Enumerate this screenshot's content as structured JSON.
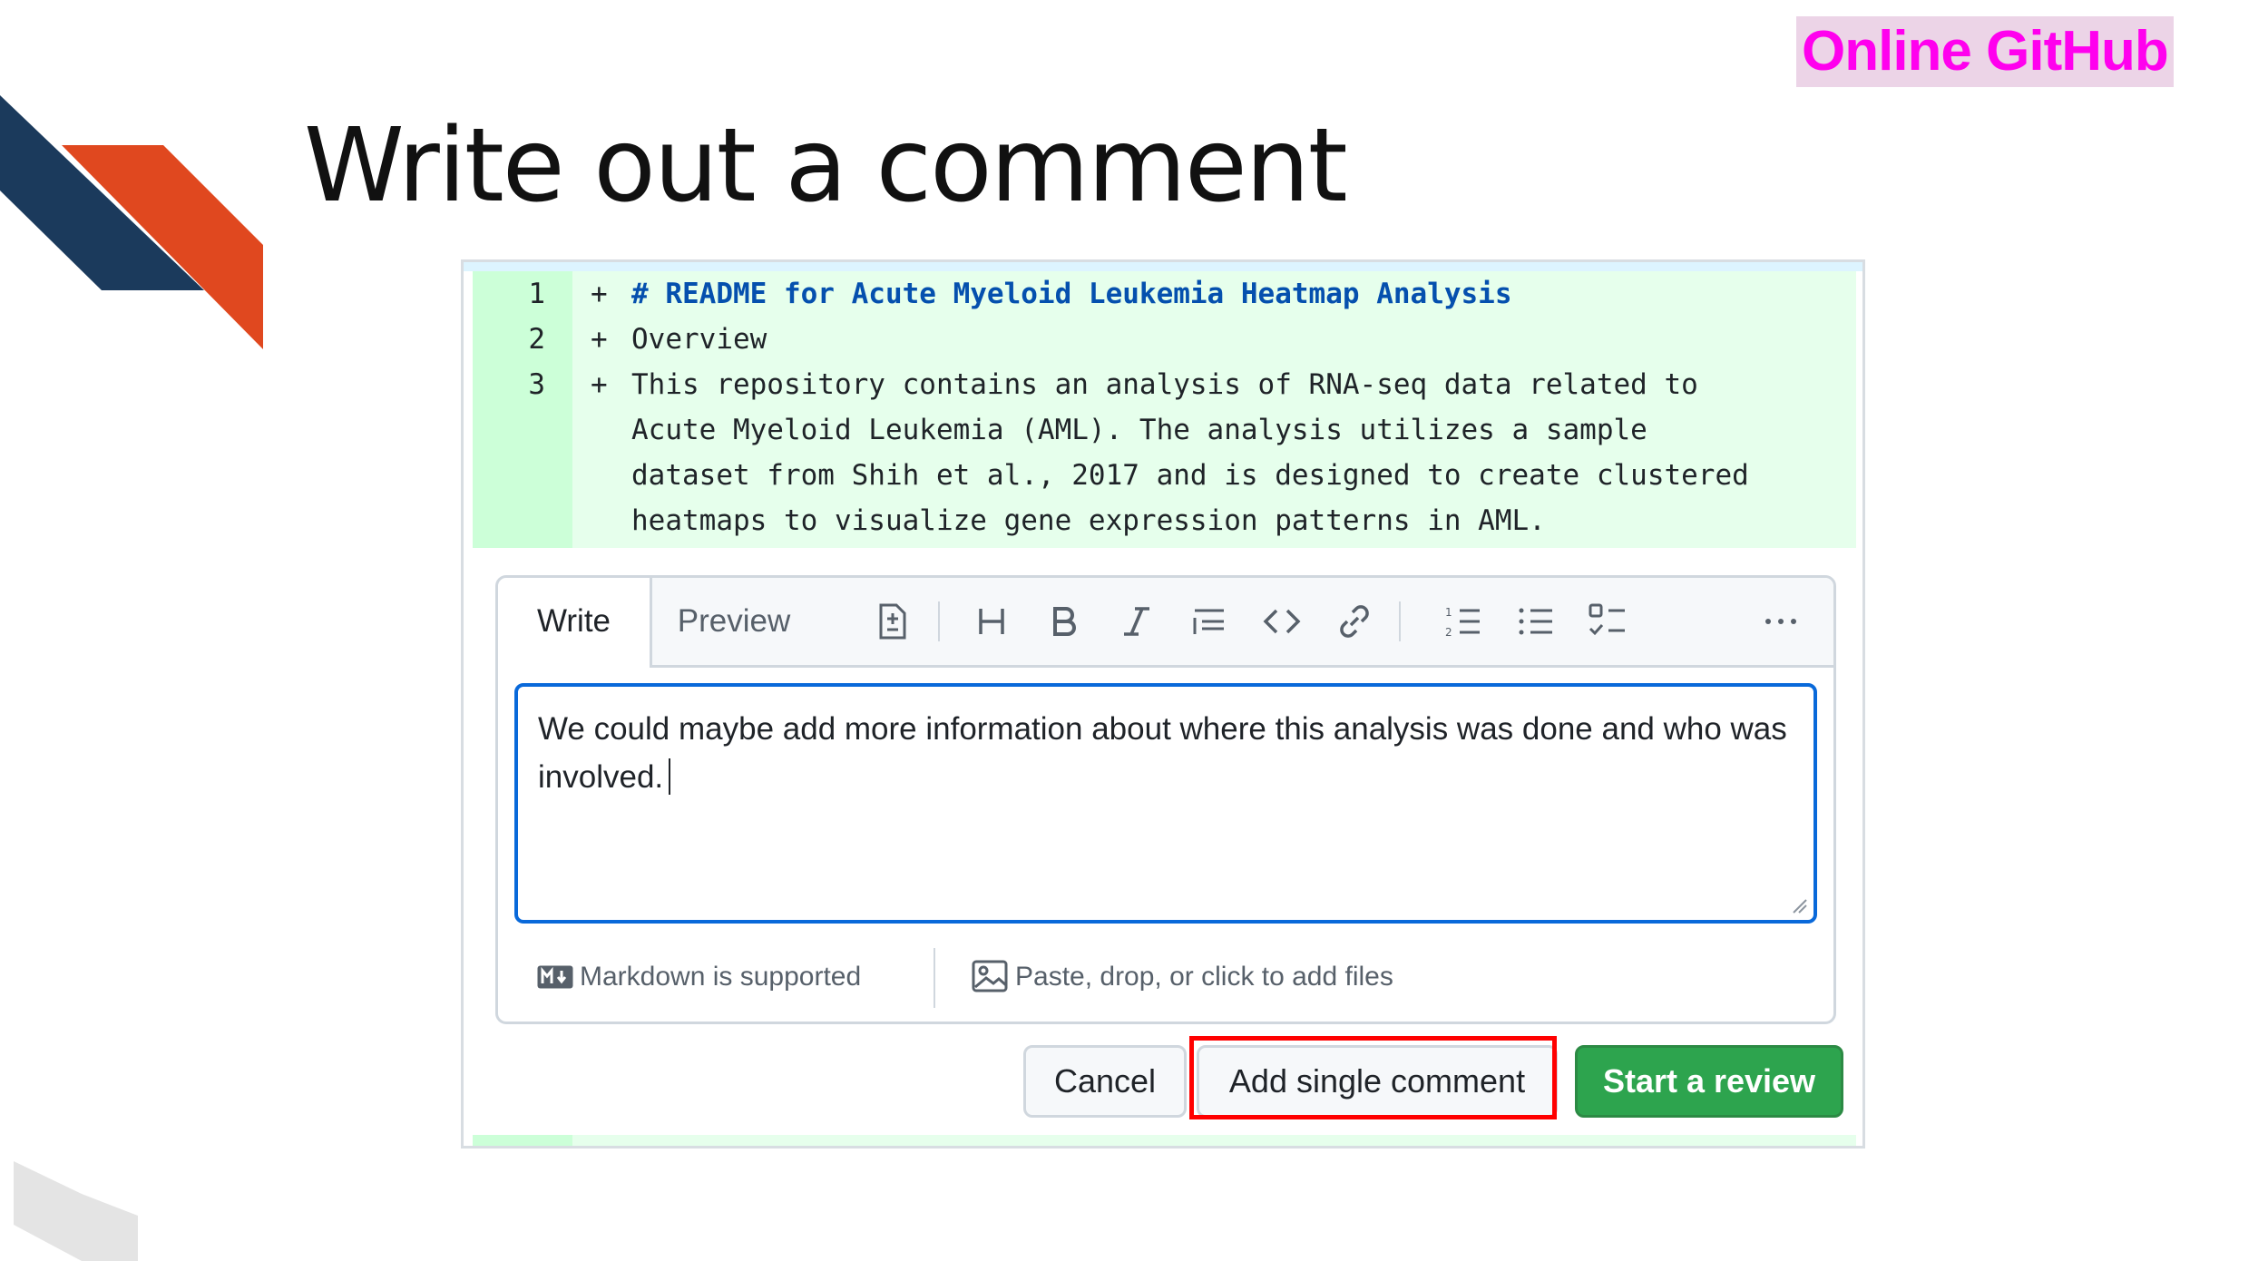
{
  "badge": "Online GitHub",
  "slide_title": "Write out a comment",
  "diff": {
    "lines": [
      {
        "num": "1",
        "sign": "+",
        "text": "# README for Acute Myeloid Leukemia Heatmap Analysis"
      },
      {
        "num": "2",
        "sign": "+",
        "text": "Overview"
      },
      {
        "num": "3",
        "sign": "+",
        "text": "This repository contains an analysis of RNA-seq data related to"
      }
    ],
    "continuation": [
      "Acute Myeloid Leukemia (AML). The analysis utilizes a sample",
      "dataset from Shih et al., 2017 and is designed to create clustered",
      "heatmaps to visualize gene expression patterns in AML."
    ]
  },
  "editor": {
    "tab_write": "Write",
    "tab_preview": "Preview",
    "toolbar_icons": [
      "diff-icon",
      "heading-icon",
      "bold-icon",
      "italic-icon",
      "quote-icon",
      "code-icon",
      "link-icon",
      "ordered-list-icon",
      "unordered-list-icon",
      "task-list-icon",
      "more-icon"
    ],
    "comment_text": "We could maybe add more information about where this analysis was done and who was involved.",
    "markdown_note": "Markdown is supported",
    "attach_note": "Paste, drop, or click to add files"
  },
  "buttons": {
    "cancel": "Cancel",
    "add_single": "Add single comment",
    "start_review": "Start a review"
  },
  "colors": {
    "accent_orange": "#e0481f",
    "accent_navy": "#1b3a5c",
    "badge_text": "#ff00ee",
    "diff_add_bg": "#e6ffec",
    "review_green": "#2da44e",
    "focus_blue": "#0969da",
    "highlight_red": "#ff0000"
  }
}
